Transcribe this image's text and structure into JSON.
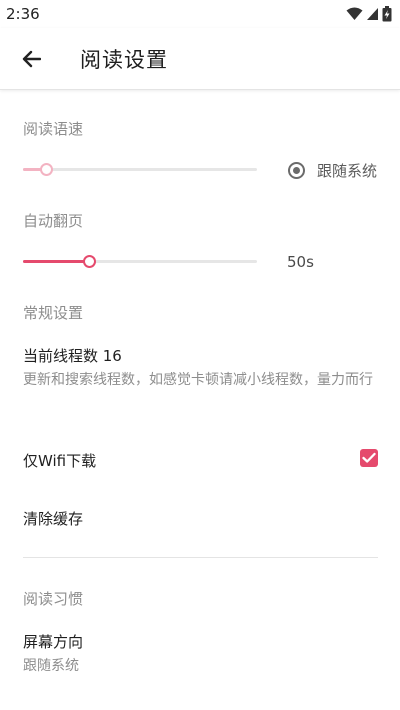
{
  "status_bar": {
    "time": "2:36",
    "icons": [
      "wifi-icon",
      "signal-icon",
      "battery-charging-icon"
    ]
  },
  "app_bar": {
    "back_icon": "arrow-left-icon",
    "title": "阅读设置"
  },
  "reading_speed": {
    "header": "阅读语速",
    "slider_value": 0.1,
    "follow_system_label": "跟随系统",
    "follow_system_selected": true
  },
  "auto_page": {
    "header": "自动翻页",
    "slider_value": 0.28,
    "value_label": "50s"
  },
  "general": {
    "header": "常规设置",
    "thread_title": "当前线程数 16",
    "thread_summary": "更新和搜索线程数，如感觉卡顿请减小线程数，量力而行",
    "wifi_only_label": "仅Wifi下载",
    "wifi_only_checked": true,
    "clear_cache_label": "清除缓存"
  },
  "reading_habits": {
    "header": "阅读习惯",
    "orientation_title": "屏幕方向",
    "orientation_summary": "跟随系统"
  },
  "colors": {
    "accent": "#e54a6d",
    "accent_light": "#f3b3c2",
    "secondary_text": "#8d8d8d"
  }
}
